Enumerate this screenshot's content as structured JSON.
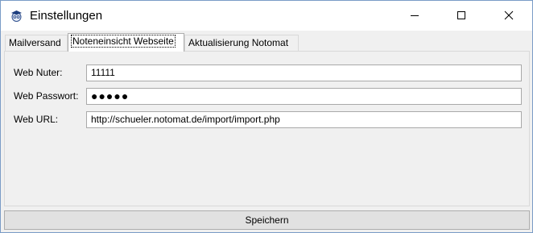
{
  "window": {
    "title": "Einstellungen",
    "icon": "owl-graduate-icon"
  },
  "tabs": [
    {
      "label": "Mailversand",
      "active": false
    },
    {
      "label": "Noteneinsicht Webseite",
      "active": true
    },
    {
      "label": "Aktualisierung Notomat",
      "active": false
    }
  ],
  "form": {
    "user_label": "Web Nuter:",
    "user_value": "11111",
    "password_label": "Web Passwort:",
    "password_value": "●●●●●",
    "url_label": "Web URL:",
    "url_value": "http://schueler.notomat.de/import/import.php"
  },
  "footer": {
    "save_label": "Speichern"
  },
  "colors": {
    "window_border": "#7a9cc7",
    "background": "#f0f0f0",
    "button": "#e1e1e1"
  }
}
